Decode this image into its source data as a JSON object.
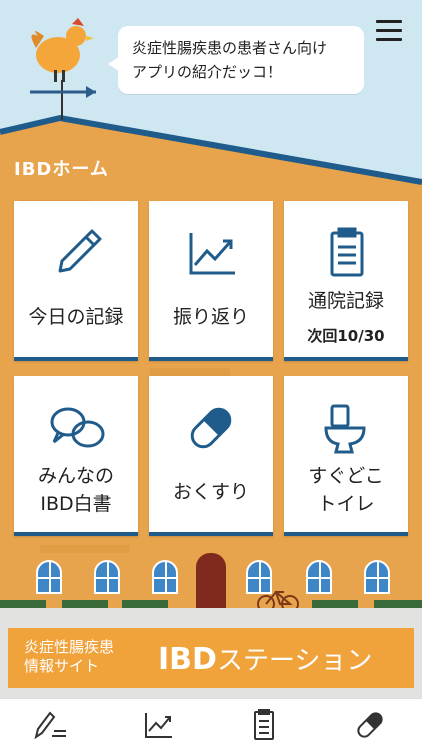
{
  "speech_bubble": {
    "line1": "炎症性腸疾患の患者さん向け",
    "line2": "アプリの紹介だッコ！"
  },
  "section_title": "IBDホーム",
  "tiles": [
    {
      "label": "今日の記録",
      "icon": "pencil-icon"
    },
    {
      "label": "振り返り",
      "icon": "chart-icon"
    },
    {
      "label": "通院記録",
      "sub": "次回10/30",
      "icon": "clipboard-icon"
    },
    {
      "label_line1": "みんなの",
      "label_line2": "IBD白書",
      "icon": "speech-bubbles-icon"
    },
    {
      "label": "おくすり",
      "icon": "capsule-icon"
    },
    {
      "label_line1": "すぐどこ",
      "label_line2": "トイレ",
      "icon": "toilet-icon"
    }
  ],
  "banner": {
    "small_line1": "炎症性腸疾患",
    "small_line2": "情報サイト",
    "big_bold": "IBD",
    "big_rest": "ステーション"
  },
  "tabbar": [
    {
      "icon": "pencil-list-icon"
    },
    {
      "icon": "chart-icon"
    },
    {
      "icon": "clipboard-icon"
    },
    {
      "icon": "capsule-icon"
    }
  ],
  "colors": {
    "accent_blue": "#1f5c8c",
    "wall": "#e8a44c",
    "sky": "#cfe7f1",
    "banner": "#f0a23b"
  }
}
